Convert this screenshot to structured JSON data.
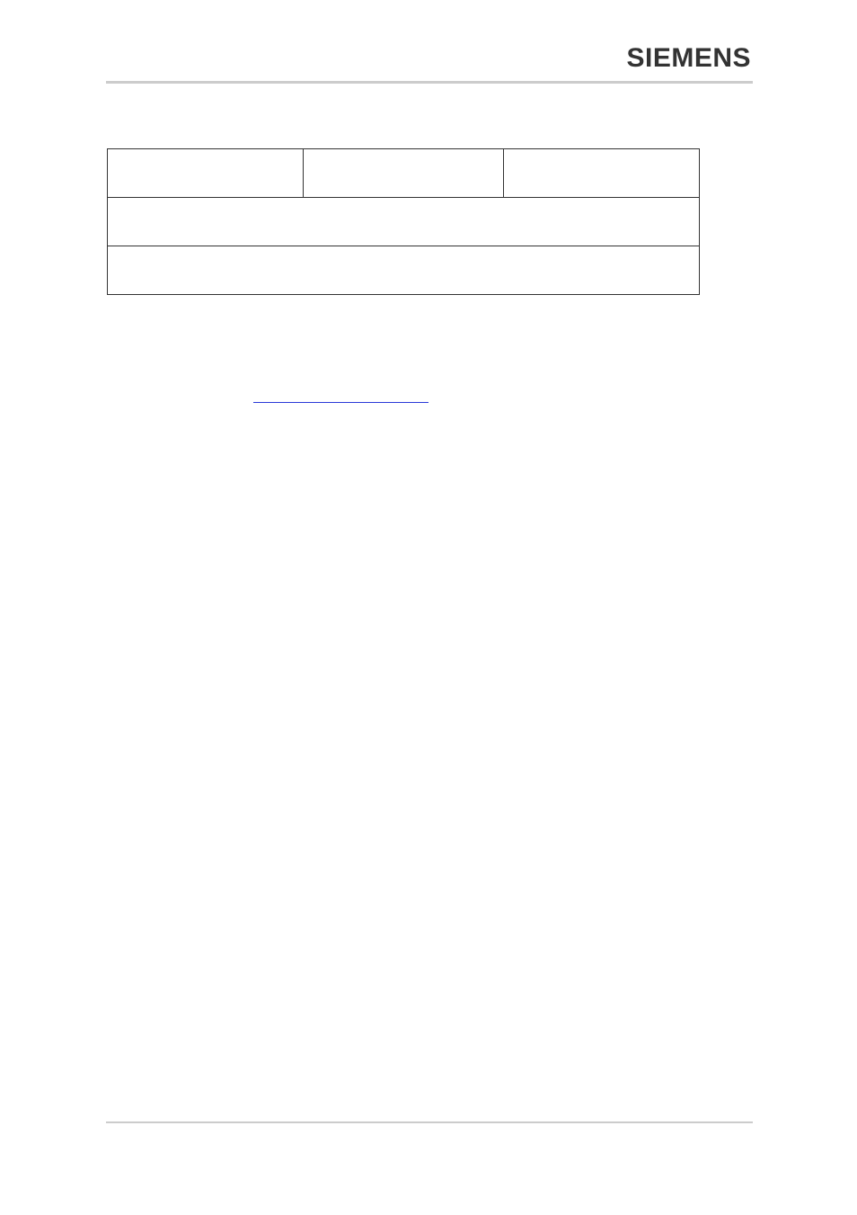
{
  "brand": "SIEMENS",
  "table": {
    "rows": [
      {
        "cells": [
          "",
          "",
          ""
        ]
      },
      {
        "cells": [
          ""
        ]
      },
      {
        "cells": [
          ""
        ]
      }
    ]
  },
  "link_text": ""
}
